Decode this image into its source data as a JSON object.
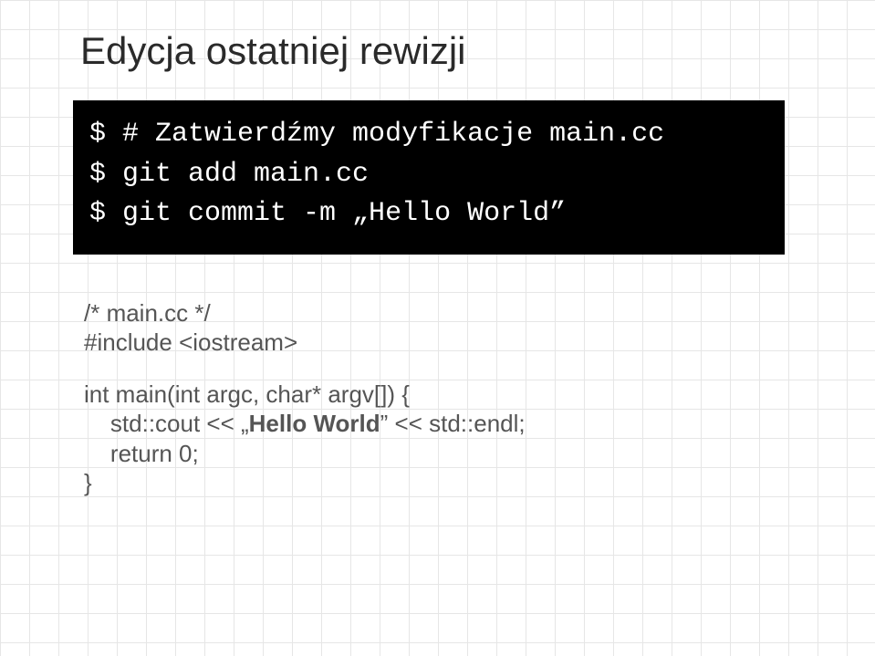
{
  "title": "Edycja ostatniej rewizji",
  "terminal": {
    "lines": [
      {
        "prompt": "$ ",
        "text": "# Zatwierdźmy modyfikacje main.cc"
      },
      {
        "prompt": "$ ",
        "text": "git add main.cc"
      },
      {
        "prompt": "$ ",
        "text": "git commit -m „Hello World”"
      }
    ]
  },
  "source": {
    "comment": "/* main.cc */",
    "include": "#include <iostream>",
    "fn_sig": "int main(int argc, char* argv[]) {",
    "body_indent": "    ",
    "cout_pre": "std::cout << „",
    "cout_bold": "Hello World",
    "cout_post": "” << std::endl;",
    "return_line": "return 0;",
    "close": "}"
  }
}
